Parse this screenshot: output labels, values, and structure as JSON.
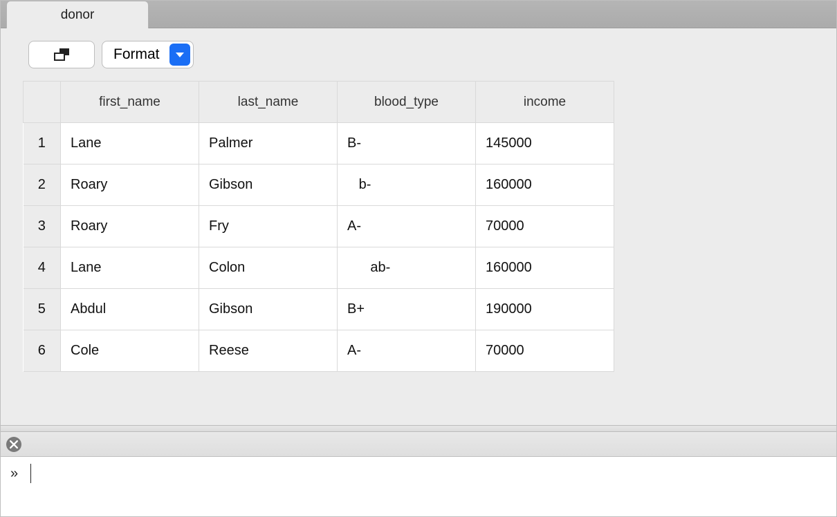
{
  "tab": {
    "label": "donor"
  },
  "toolbar": {
    "format_label": "Format"
  },
  "table": {
    "headers": [
      "first_name",
      "last_name",
      "blood_type",
      "income"
    ],
    "rows": [
      {
        "n": "1",
        "first_name": "Lane",
        "last_name": "Palmer",
        "blood_type": "B-",
        "income": "145000"
      },
      {
        "n": "2",
        "first_name": "Roary",
        "last_name": "Gibson",
        "blood_type": "   b-",
        "income": "160000"
      },
      {
        "n": "3",
        "first_name": "Roary",
        "last_name": "Fry",
        "blood_type": "A-",
        "income": "70000"
      },
      {
        "n": "4",
        "first_name": "Lane",
        "last_name": "Colon",
        "blood_type": "      ab-",
        "income": "160000"
      },
      {
        "n": "5",
        "first_name": "Abdul",
        "last_name": "Gibson",
        "blood_type": "B+",
        "income": "190000"
      },
      {
        "n": "6",
        "first_name": "Cole",
        "last_name": "Reese",
        "blood_type": "A-",
        "income": "70000"
      }
    ]
  },
  "console": {
    "prompt": "»",
    "input_value": ""
  }
}
